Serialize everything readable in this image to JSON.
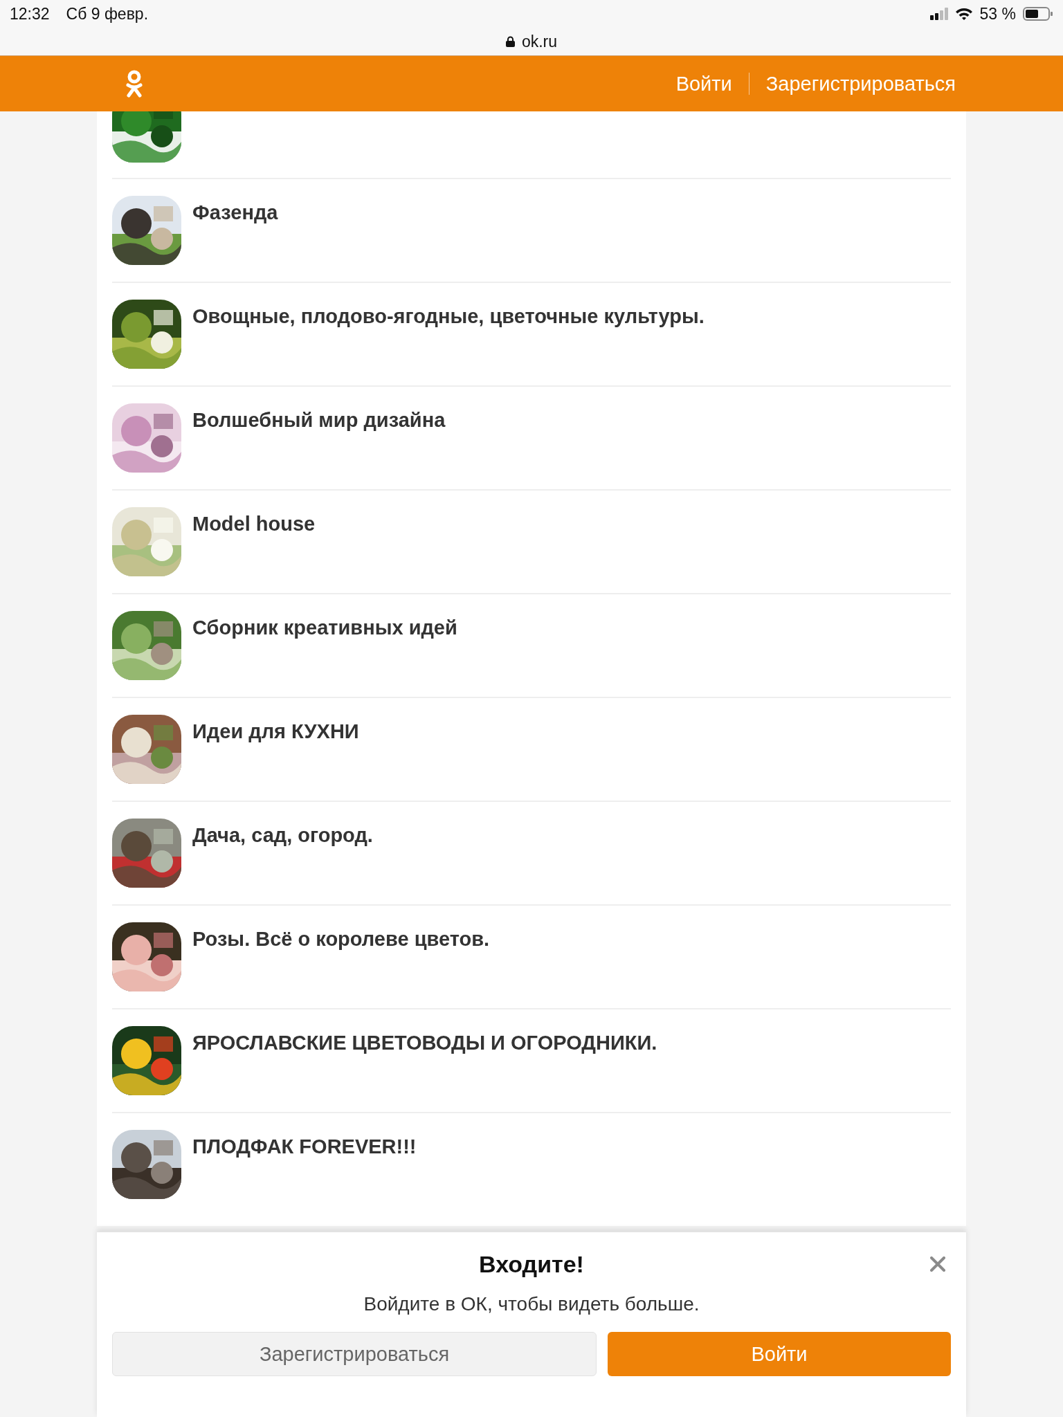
{
  "status_bar": {
    "time": "12:32",
    "date": "Сб 9 февр.",
    "battery": "53 %"
  },
  "address_bar": {
    "url": "ok.ru"
  },
  "header": {
    "links": [
      "Войти",
      "Зарегистрироваться"
    ]
  },
  "groups": [
    {
      "title": "Фазенда"
    },
    {
      "title": "Овощные, плодово-ягодные, цветочные культуры."
    },
    {
      "title": "Волшебный мир дизайна"
    },
    {
      "title": "Model house"
    },
    {
      "title": "Сборник креативных идей"
    },
    {
      "title": "Идеи для КУХНИ"
    },
    {
      "title": "Дача, сад, огород."
    },
    {
      "title": "Розы. Всё о королеве цветов."
    },
    {
      "title": "ЯРОСЛАВСКИЕ ЦВЕТОВОДЫ И ОГОРОДНИКИ."
    },
    {
      "title": "ПЛОДФАК FOREVER!!!"
    }
  ],
  "login_prompt": {
    "title": "Входите!",
    "message": "Войдите в ОК, чтобы видеть больше.",
    "buttons": [
      {
        "kind": "secondary",
        "label": "Зарегистрироваться"
      },
      {
        "kind": "primary",
        "label": "Войти"
      }
    ]
  }
}
